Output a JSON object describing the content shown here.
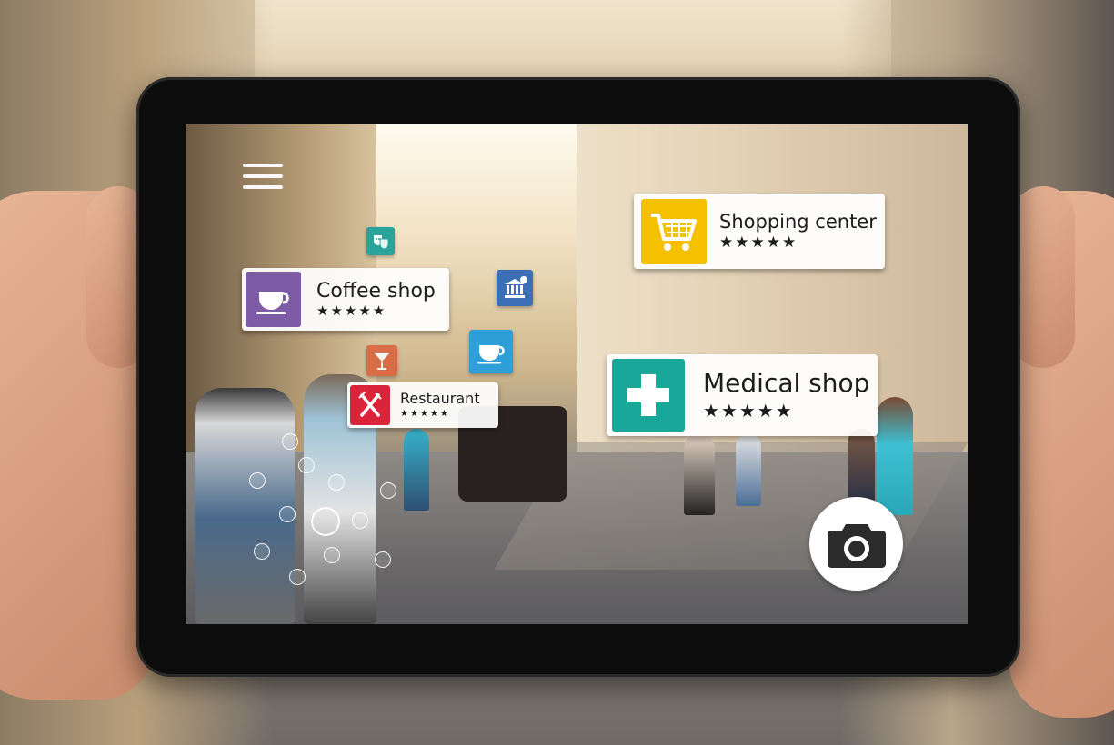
{
  "pois": {
    "shopping": {
      "label": "Shopping center",
      "stars": "★★★★★"
    },
    "coffee": {
      "label": "Coffee shop",
      "stars": "★★★★★"
    },
    "restaurant": {
      "label": "Restaurant",
      "stars": "★★★★★"
    },
    "medical": {
      "label": "Medical shop",
      "stars": "★★★★★"
    }
  },
  "icons": {
    "menu": "hamburger-menu-icon",
    "theater": "theater-masks-icon",
    "bank": "bank-icon",
    "bar": "cocktail-icon",
    "cafe": "coffee-cup-icon",
    "camera": "camera-icon"
  },
  "colors": {
    "shopping": "#f5c000",
    "coffee": "#7e5ba6",
    "restaurant": "#d9243a",
    "medical": "#19a79a",
    "theater": "#2aa39a",
    "bank": "#3a6fb5",
    "bar": "#d9603a",
    "cafe": "#2f9fd8"
  }
}
